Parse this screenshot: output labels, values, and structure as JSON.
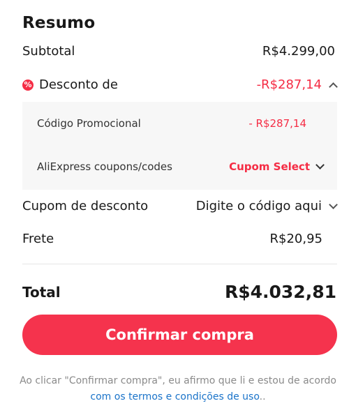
{
  "summary": {
    "title": "Resumo",
    "subtotal_label": "Subtotal",
    "subtotal_value": "R$4.299,00",
    "discount_label": "Desconto de",
    "discount_value": "-R$287,14",
    "discount_icon": "discount-percent-icon",
    "promo_code_label": "Código Promocional",
    "promo_code_value": "- R$287,14",
    "ae_coupons_label": "AliExpress coupons/codes",
    "ae_coupons_select": "Cupom Select",
    "coupon_label": "Cupom de desconto",
    "coupon_placeholder": "Digite o código aqui",
    "shipping_label": "Frete",
    "shipping_value": "R$20,95",
    "total_label": "Total",
    "total_value": "R$4.032,81"
  },
  "actions": {
    "confirm_label": "Confirmar compra"
  },
  "legal": {
    "text_prefix": "Ao clicar \"Confirmar compra\", eu afirmo que li e estou de acordo ",
    "link_text": "com os termos e condições de uso",
    "text_suffix": ".."
  },
  "colors": {
    "accent": "#f52d45",
    "button": "#f5334d",
    "link": "#1a73c9",
    "panel_bg": "#f7f7f7"
  }
}
